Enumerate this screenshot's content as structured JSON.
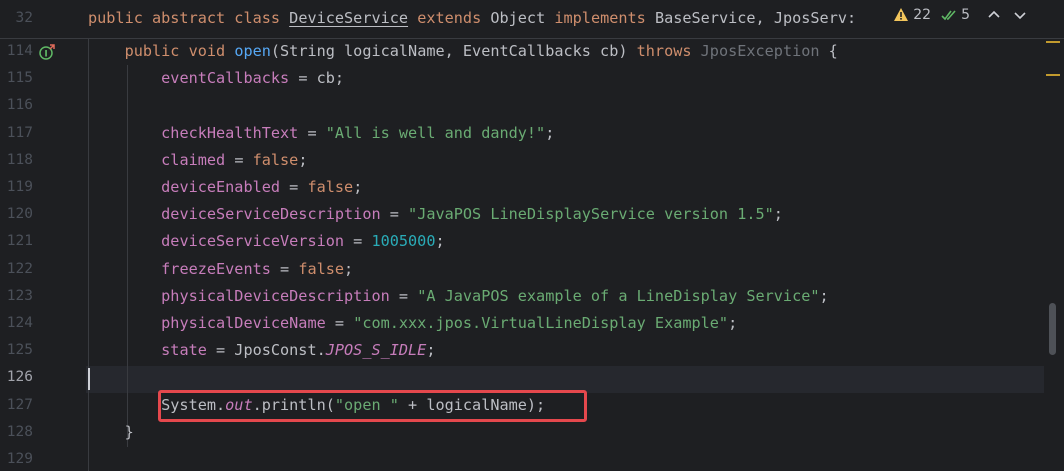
{
  "sticky": {
    "line_number": "32",
    "tokens": [
      {
        "t": "public abstract class ",
        "c": "kw"
      },
      {
        "t": "DeviceService",
        "c": "cls-u"
      },
      {
        "t": " ",
        "c": "plain"
      },
      {
        "t": "extends ",
        "c": "kw"
      },
      {
        "t": "Object ",
        "c": "plain"
      },
      {
        "t": "implements ",
        "c": "kw"
      },
      {
        "t": "BaseService, JposServ:",
        "c": "plain"
      }
    ]
  },
  "inspections": {
    "warnings": "22",
    "checks": "5"
  },
  "lines": [
    {
      "n": "114",
      "tokens": [
        {
          "t": "    public void ",
          "c": "kw"
        },
        {
          "t": "open",
          "c": "fn"
        },
        {
          "t": "(String logicalName, EventCallbacks cb) ",
          "c": "plain"
        },
        {
          "t": "throws ",
          "c": "kw"
        },
        {
          "t": "JposException",
          "c": "dim"
        },
        {
          "t": " {",
          "c": "plain"
        }
      ]
    },
    {
      "n": "115",
      "tokens": [
        {
          "t": "        ",
          "c": "plain"
        },
        {
          "t": "eventCallbacks",
          "c": "field"
        },
        {
          "t": " = cb;",
          "c": "plain"
        }
      ]
    },
    {
      "n": "116",
      "tokens": []
    },
    {
      "n": "117",
      "tokens": [
        {
          "t": "        ",
          "c": "plain"
        },
        {
          "t": "checkHealthText",
          "c": "field"
        },
        {
          "t": " = ",
          "c": "plain"
        },
        {
          "t": "\"All is well and dandy!\"",
          "c": "str"
        },
        {
          "t": ";",
          "c": "plain"
        }
      ]
    },
    {
      "n": "118",
      "tokens": [
        {
          "t": "        ",
          "c": "plain"
        },
        {
          "t": "claimed",
          "c": "field"
        },
        {
          "t": " = ",
          "c": "plain"
        },
        {
          "t": "false",
          "c": "kw"
        },
        {
          "t": ";",
          "c": "plain"
        }
      ]
    },
    {
      "n": "119",
      "tokens": [
        {
          "t": "        ",
          "c": "plain"
        },
        {
          "t": "deviceEnabled",
          "c": "field"
        },
        {
          "t": " = ",
          "c": "plain"
        },
        {
          "t": "false",
          "c": "kw"
        },
        {
          "t": ";",
          "c": "plain"
        }
      ]
    },
    {
      "n": "120",
      "tokens": [
        {
          "t": "        ",
          "c": "plain"
        },
        {
          "t": "deviceServiceDescription",
          "c": "field"
        },
        {
          "t": " = ",
          "c": "plain"
        },
        {
          "t": "\"JavaPOS LineDisplayService version 1.5\"",
          "c": "str"
        },
        {
          "t": ";",
          "c": "plain"
        }
      ]
    },
    {
      "n": "121",
      "tokens": [
        {
          "t": "        ",
          "c": "plain"
        },
        {
          "t": "deviceServiceVersion",
          "c": "field"
        },
        {
          "t": " = ",
          "c": "plain"
        },
        {
          "t": "1005000",
          "c": "num"
        },
        {
          "t": ";",
          "c": "plain"
        }
      ]
    },
    {
      "n": "122",
      "tokens": [
        {
          "t": "        ",
          "c": "plain"
        },
        {
          "t": "freezeEvents",
          "c": "field"
        },
        {
          "t": " = ",
          "c": "plain"
        },
        {
          "t": "false",
          "c": "kw"
        },
        {
          "t": ";",
          "c": "plain"
        }
      ]
    },
    {
      "n": "123",
      "tokens": [
        {
          "t": "        ",
          "c": "plain"
        },
        {
          "t": "physicalDeviceDescription",
          "c": "field"
        },
        {
          "t": " = ",
          "c": "plain"
        },
        {
          "t": "\"A JavaPOS example of a LineDisplay Service\"",
          "c": "str"
        },
        {
          "t": ";",
          "c": "plain"
        }
      ]
    },
    {
      "n": "124",
      "tokens": [
        {
          "t": "        ",
          "c": "plain"
        },
        {
          "t": "physicalDeviceName",
          "c": "field"
        },
        {
          "t": " = ",
          "c": "plain"
        },
        {
          "t": "\"com.xxx.jpos.VirtualLineDisplay Example\"",
          "c": "str"
        },
        {
          "t": ";",
          "c": "plain"
        }
      ]
    },
    {
      "n": "125",
      "tokens": [
        {
          "t": "        ",
          "c": "plain"
        },
        {
          "t": "state",
          "c": "field"
        },
        {
          "t": " = JposConst.",
          "c": "plain"
        },
        {
          "t": "JPOS_S_IDLE",
          "c": "static-it"
        },
        {
          "t": ";",
          "c": "plain"
        }
      ]
    },
    {
      "n": "126",
      "tokens": [],
      "current": true
    },
    {
      "n": "127",
      "tokens": [
        {
          "t": "        System.",
          "c": "plain"
        },
        {
          "t": "out",
          "c": "out-it"
        },
        {
          "t": ".println(",
          "c": "plain"
        },
        {
          "t": "\"open \"",
          "c": "str"
        },
        {
          "t": " + logicalName);",
          "c": "plain"
        }
      ]
    },
    {
      "n": "128",
      "tokens": [
        {
          "t": "    }",
          "c": "plain"
        }
      ]
    },
    {
      "n": "129",
      "tokens": []
    }
  ]
}
